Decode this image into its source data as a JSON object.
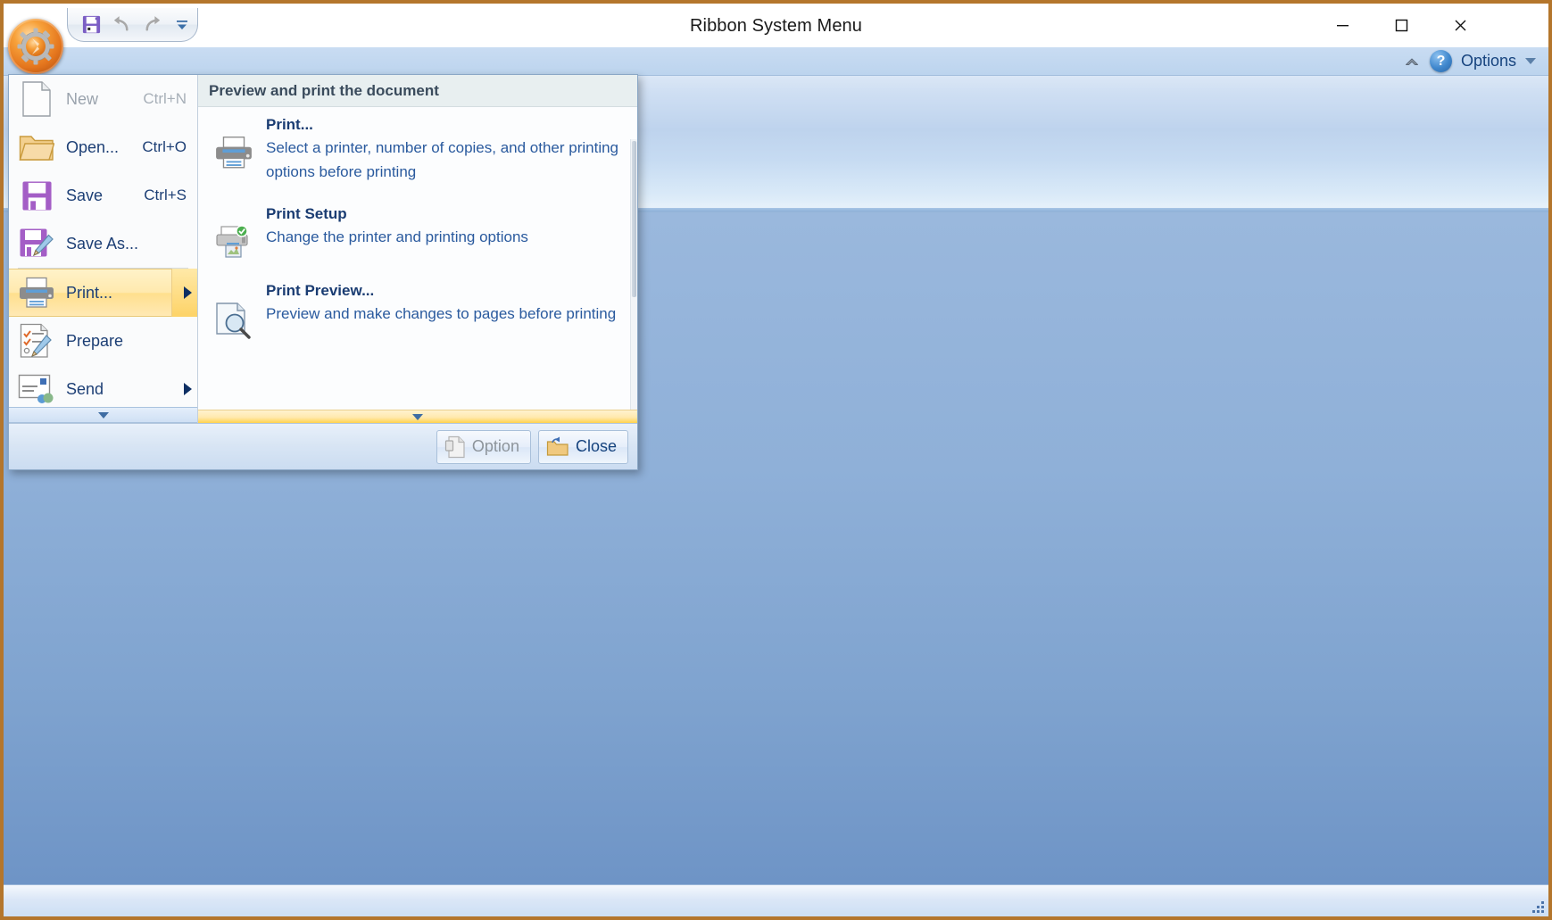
{
  "window": {
    "title": "Ribbon System Menu",
    "controls": {
      "minimize": "minimize-icon",
      "maximize": "maximize-icon",
      "close": "close-icon"
    },
    "frame_color": "#b4762c"
  },
  "quick_access_toolbar": {
    "items": [
      {
        "name": "save-icon",
        "label": "Save",
        "enabled": true
      },
      {
        "name": "undo-icon",
        "label": "Undo",
        "enabled": false
      },
      {
        "name": "redo-icon",
        "label": "Redo",
        "enabled": false
      },
      {
        "name": "customize-qat-icon",
        "label": "Customize Quick Access Toolbar",
        "enabled": true
      }
    ]
  },
  "app_button": {
    "name": "office-orb-button",
    "tooltip": "Ribbon System Menu",
    "color": "#e4751d"
  },
  "ribbon": {
    "minimize_icon": "chevron-up-icon",
    "help_icon": "?",
    "options_label": "Options",
    "options_dropdown_icon": "chevron-down-icon"
  },
  "system_menu": {
    "left_items": [
      {
        "label": "New",
        "accel": "Ctrl+N",
        "icon": "new-document-icon",
        "enabled": false,
        "submenu": false,
        "selected": false
      },
      {
        "label": "Open...",
        "accel": "Ctrl+O",
        "icon": "open-folder-icon",
        "enabled": true,
        "submenu": false,
        "selected": false
      },
      {
        "label": "Save",
        "accel": "Ctrl+S",
        "icon": "save-floppy-icon",
        "enabled": true,
        "submenu": false,
        "selected": false
      },
      {
        "label": "Save As...",
        "accel": "",
        "icon": "save-as-icon",
        "enabled": true,
        "submenu": false,
        "selected": false
      },
      {
        "label": "Print...",
        "accel": "",
        "icon": "printer-icon",
        "enabled": true,
        "submenu": true,
        "selected": true
      },
      {
        "label": "Prepare",
        "accel": "",
        "icon": "prepare-document-icon",
        "enabled": true,
        "submenu": false,
        "selected": false
      },
      {
        "label": "Send",
        "accel": "",
        "icon": "send-icon",
        "enabled": true,
        "submenu": true,
        "selected": false
      }
    ],
    "left_scroll_down_icon": "chevron-down-icon",
    "right_header": "Preview and print the document",
    "right_items": [
      {
        "title": "Print...",
        "desc": "Select a printer, number of copies, and other printing options before printing",
        "icon": "printer-icon"
      },
      {
        "title": "Print Setup",
        "desc": "Change the printer and printing options",
        "icon": "printer-setup-icon"
      },
      {
        "title": "Print Preview...",
        "desc": "Preview and make changes to pages before printing",
        "icon": "print-preview-icon"
      }
    ],
    "right_scroll_down_icon": "chevron-down-icon",
    "footer": {
      "option_button": {
        "label": "Option",
        "icon": "options-document-icon",
        "enabled": false
      },
      "close_button": {
        "label": "Close",
        "icon": "exit-folder-icon",
        "enabled": true
      }
    }
  },
  "status_bar": {
    "resize_grip": "resize-grip-icon"
  }
}
